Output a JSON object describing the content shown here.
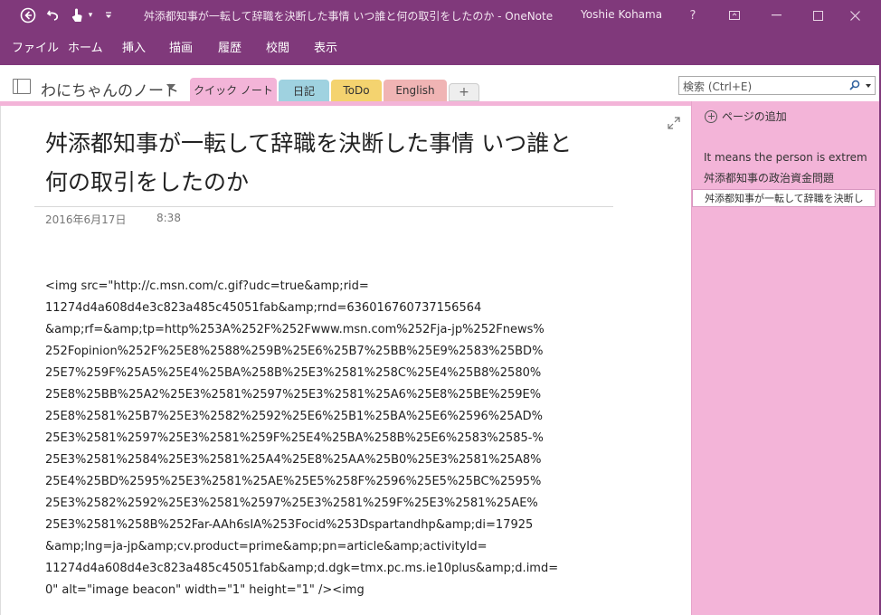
{
  "window": {
    "title": "舛添都知事が一転して辞職を決断した事情 いつ誰と何の取引をしたのか - OneNote",
    "user": "Yoshie Kohama",
    "help": "?",
    "controls": {
      "ribbon_display": "▭",
      "minimize": "—",
      "maximize": "☐",
      "close": "✕"
    }
  },
  "quick_access": {
    "back": "⊙",
    "undo": "↶",
    "touch": "✋",
    "more": "▾"
  },
  "ribbon": {
    "tabs": [
      "ファイル",
      "ホーム",
      "挿入",
      "描画",
      "履歴",
      "校閲",
      "表示"
    ]
  },
  "notebook": {
    "name": "わにちゃんのノート",
    "sections": [
      {
        "label": "クイック ノート",
        "color": "#f3b4d8"
      },
      {
        "label": "日記",
        "color": "#9fd2e0"
      },
      {
        "label": "ToDo",
        "color": "#f4d36f"
      },
      {
        "label": "English",
        "color": "#f0b4b4"
      },
      {
        "label": "+",
        "color": "#eeeeee"
      }
    ]
  },
  "search": {
    "placeholder": "検索 (Ctrl+E)"
  },
  "page": {
    "title": "舛添都知事が一転して辞職を決断した事情 いつ誰と何の取引をしたのか",
    "title_lines": [
      "舛添都知事が一転して辞職を決断した事情 いつ誰と",
      "何の取引をしたのか"
    ],
    "date": "2016年6月17日",
    "time": "8:38",
    "body_lines": [
      "<img src=\"http://c.msn.com/c.gif?udc=true&amp;rid=",
      "11274d4a608d4e3c823a485c45051fab&amp;rnd=636016760737156564",
      "&amp;rf=&amp;tp=http%253A%252F%252Fwww.msn.com%252Fja-jp%252Fnews%",
      "252Fopinion%252F%25E8%2588%259B%25E6%25B7%25BB%25E9%2583%25BD%",
      "25E7%259F%25A5%25E4%25BA%258B%25E3%2581%258C%25E4%25B8%2580%",
      "25E8%25BB%25A2%25E3%2581%2597%25E3%2581%25A6%25E8%25BE%259E%",
      "25E8%2581%25B7%25E3%2582%2592%25E6%25B1%25BA%25E6%2596%25AD%",
      "25E3%2581%2597%25E3%2581%259F%25E4%25BA%258B%25E6%2583%2585-%",
      "25E3%2581%2584%25E3%2581%25A4%25E8%25AA%25B0%25E3%2581%25A8%",
      "25E4%25BD%2595%25E3%2581%25AE%25E5%258F%2596%25E5%25BC%2595%",
      "25E3%2582%2592%25E3%2581%2597%25E3%2581%259F%25E3%2581%25AE%",
      "25E3%2581%258B%252Far-AAh6sIA%253Focid%253Dspartandhp&amp;di=17925",
      "&amp;lng=ja-jp&amp;cv.product=prime&amp;pn=article&amp;activityId=",
      "11274d4a608d4e3c823a485c45051fab&amp;d.dgk=tmx.pc.ms.ie10plus&amp;d.imd=",
      "0\" alt=\"image beacon\" width=\"1\" height=\"1\" /><img"
    ]
  },
  "pages_panel": {
    "add_page": "ページの追加",
    "items": [
      "It means the person is extrem",
      "舛添都知事の政治資金問題",
      "舛添都知事が一転して辞職を決断し"
    ],
    "selected_index": 2
  },
  "colors": {
    "accent": "#80397b",
    "section_pink": "#f3b4d8"
  }
}
